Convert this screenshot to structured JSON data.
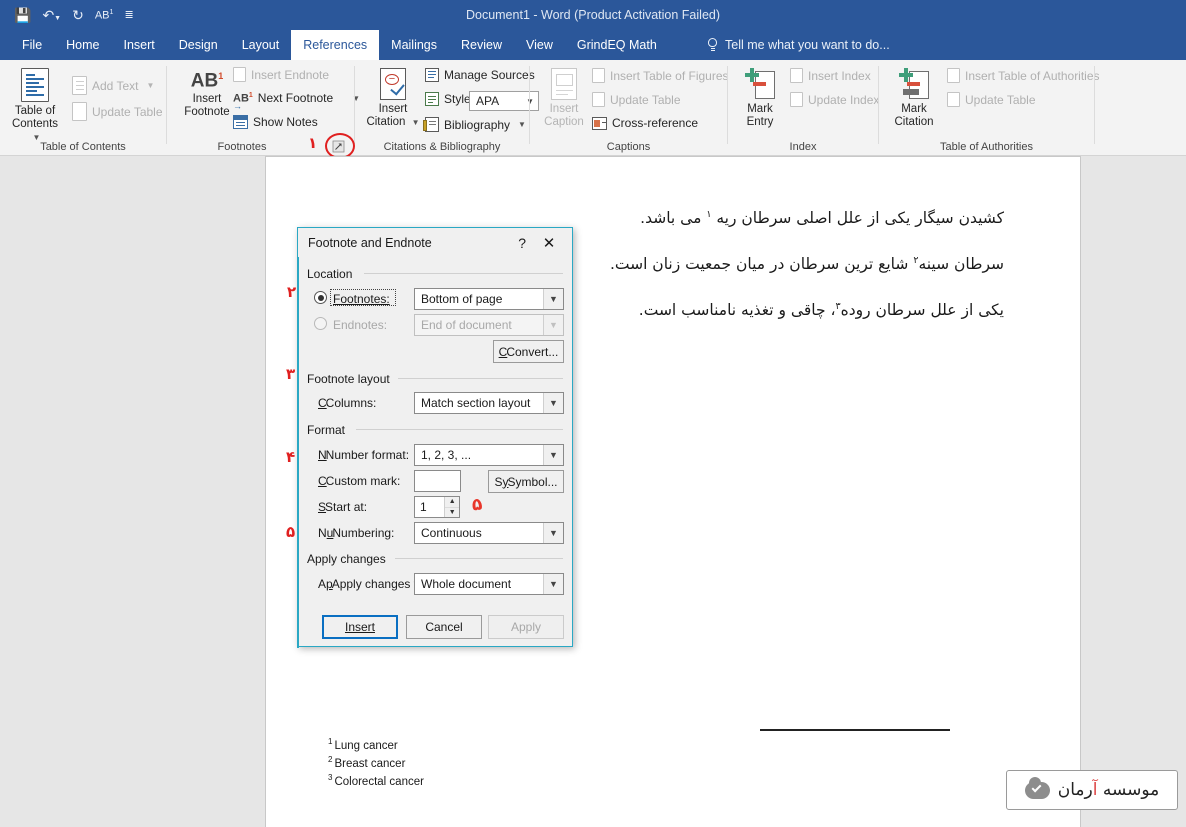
{
  "window": {
    "title": "Document1 - Word (Product Activation Failed)",
    "quick_access": [
      "save-icon",
      "undo-icon",
      "redo-icon",
      "footnote-icon",
      "customize-qat-icon"
    ]
  },
  "tabs": [
    {
      "label": "File",
      "active": false
    },
    {
      "label": "Home",
      "active": false
    },
    {
      "label": "Insert",
      "active": false
    },
    {
      "label": "Design",
      "active": false
    },
    {
      "label": "Layout",
      "active": false
    },
    {
      "label": "References",
      "active": true
    },
    {
      "label": "Mailings",
      "active": false
    },
    {
      "label": "Review",
      "active": false
    },
    {
      "label": "View",
      "active": false
    },
    {
      "label": "GrindEQ Math",
      "active": false
    }
  ],
  "tell_me": {
    "placeholder": "Tell me what you want to do...",
    "icon": "lightbulb-icon"
  },
  "ribbon": {
    "groups": [
      {
        "name": "Table of Contents",
        "label": "Table of Contents",
        "big_button": "Table of\nContents",
        "big_button_line1": "Table of",
        "big_button_line2": "Contents",
        "small_buttons": [
          {
            "label": "Add Text",
            "disabled": true,
            "dropdown": true
          },
          {
            "label": "Update Table",
            "disabled": true,
            "dropdown": false
          }
        ]
      },
      {
        "name": "Footnotes",
        "label": "Footnotes",
        "big_button_line1": "Insert",
        "big_button_line2": "Footnote",
        "small_buttons": [
          {
            "label": "Insert Endnote",
            "disabled": true,
            "dropdown": false
          },
          {
            "label": "Next Footnote",
            "disabled": false,
            "dropdown": true
          },
          {
            "label": "Show Notes",
            "disabled": false,
            "dropdown": false
          }
        ],
        "has_dialog_launcher": true
      },
      {
        "name": "Citations & Bibliography",
        "label": "Citations & Bibliography",
        "big_button_line1": "Insert",
        "big_button_line2": "Citation",
        "small_buttons": [
          {
            "label": "Manage Sources",
            "disabled": false,
            "dropdown": false
          },
          {
            "label": "Style:",
            "disabled": false,
            "dropdown": false
          },
          {
            "label": "Bibliography",
            "disabled": false,
            "dropdown": true
          }
        ],
        "style_value": "APA"
      },
      {
        "name": "Captions",
        "label": "Captions",
        "big_button_line1": "Insert",
        "big_button_line2": "Caption",
        "big_button_disabled": true,
        "small_buttons": [
          {
            "label": "Insert Table of Figures",
            "disabled": true,
            "dropdown": false
          },
          {
            "label": "Update Table",
            "disabled": true,
            "dropdown": false
          },
          {
            "label": "Cross-reference",
            "disabled": false,
            "dropdown": false
          }
        ]
      },
      {
        "name": "Index",
        "label": "Index",
        "big_button_line1": "Mark",
        "big_button_line2": "Entry",
        "small_buttons": [
          {
            "label": "Insert Index",
            "disabled": true,
            "dropdown": false
          },
          {
            "label": "Update Index",
            "disabled": true,
            "dropdown": false
          }
        ]
      },
      {
        "name": "Table of Authorities",
        "label": "Table of Authorities",
        "big_button_line1": "Mark",
        "big_button_line2": "Citation",
        "small_buttons": [
          {
            "label": "Insert Table of Authorities",
            "disabled": true,
            "dropdown": false
          },
          {
            "label": "Update Table",
            "disabled": true,
            "dropdown": false
          }
        ]
      }
    ]
  },
  "document": {
    "paragraphs": [
      {
        "text": "کشیدن سیگار یکی از علل اصلی سرطان ریه ",
        "marker": "١",
        "tail": " می باشد."
      },
      {
        "text": "سرطان سینه",
        "marker": "٢",
        "tail": " شایع ترین سرطان در میان جمعیت زنان است."
      },
      {
        "text": "یکی از علل سرطان روده",
        "marker": "٣",
        "tail": "، چاقی و تغذیه نامناسب است."
      }
    ],
    "footnotes": [
      {
        "marker": "1",
        "text": "Lung cancer"
      },
      {
        "marker": "2",
        "text": "Breast cancer"
      },
      {
        "marker": "3",
        "text": "Colorectal cancer"
      }
    ]
  },
  "dialog": {
    "title": "Footnote and Endnote",
    "help_label": "?",
    "close_label": "✕",
    "location": {
      "group_label": "Location",
      "footnotes_radio": "Footnotes:",
      "footnotes_selected": true,
      "footnotes_value": "Bottom of page",
      "endnotes_radio": "Endnotes:",
      "endnotes_selected": false,
      "endnotes_value": "End of document",
      "convert_button": "Convert..."
    },
    "footnote_layout": {
      "group_label": "Footnote layout",
      "columns_label": "Columns:",
      "columns_value": "Match section layout"
    },
    "format": {
      "group_label": "Format",
      "number_format_label": "Number format:",
      "number_format_value": "1, 2, 3, ...",
      "custom_mark_label": "Custom mark:",
      "custom_mark_value": "",
      "symbol_button": "Symbol...",
      "start_at_label": "Start at:",
      "start_at_value": "1",
      "numbering_label": "Numbering:",
      "numbering_value": "Continuous"
    },
    "apply_changes": {
      "group_label": "Apply changes",
      "apply_to_label": "Apply changes to:",
      "apply_to_value": "Whole document"
    },
    "buttons": {
      "insert": "Insert",
      "cancel": "Cancel",
      "apply": "Apply",
      "apply_disabled": true
    }
  },
  "annotations": [
    {
      "id": "a1",
      "label": "١"
    },
    {
      "id": "a2",
      "label": "٢"
    },
    {
      "id": "a3",
      "label": "٣"
    },
    {
      "id": "a4",
      "label": "۴"
    },
    {
      "id": "a5",
      "label": "۵"
    },
    {
      "id": "a6",
      "label": "۵"
    }
  ],
  "logo": {
    "text_main": "موسسه ",
    "text_accent": "آ",
    "text_rest": "رمان",
    "icon": "cloud-check-icon"
  },
  "colors": {
    "ribbon_blue": "#2b579a",
    "dialog_border": "#2aa8c4",
    "annotation_red": "#e02020",
    "default_button_blue": "#0a6fc2"
  }
}
